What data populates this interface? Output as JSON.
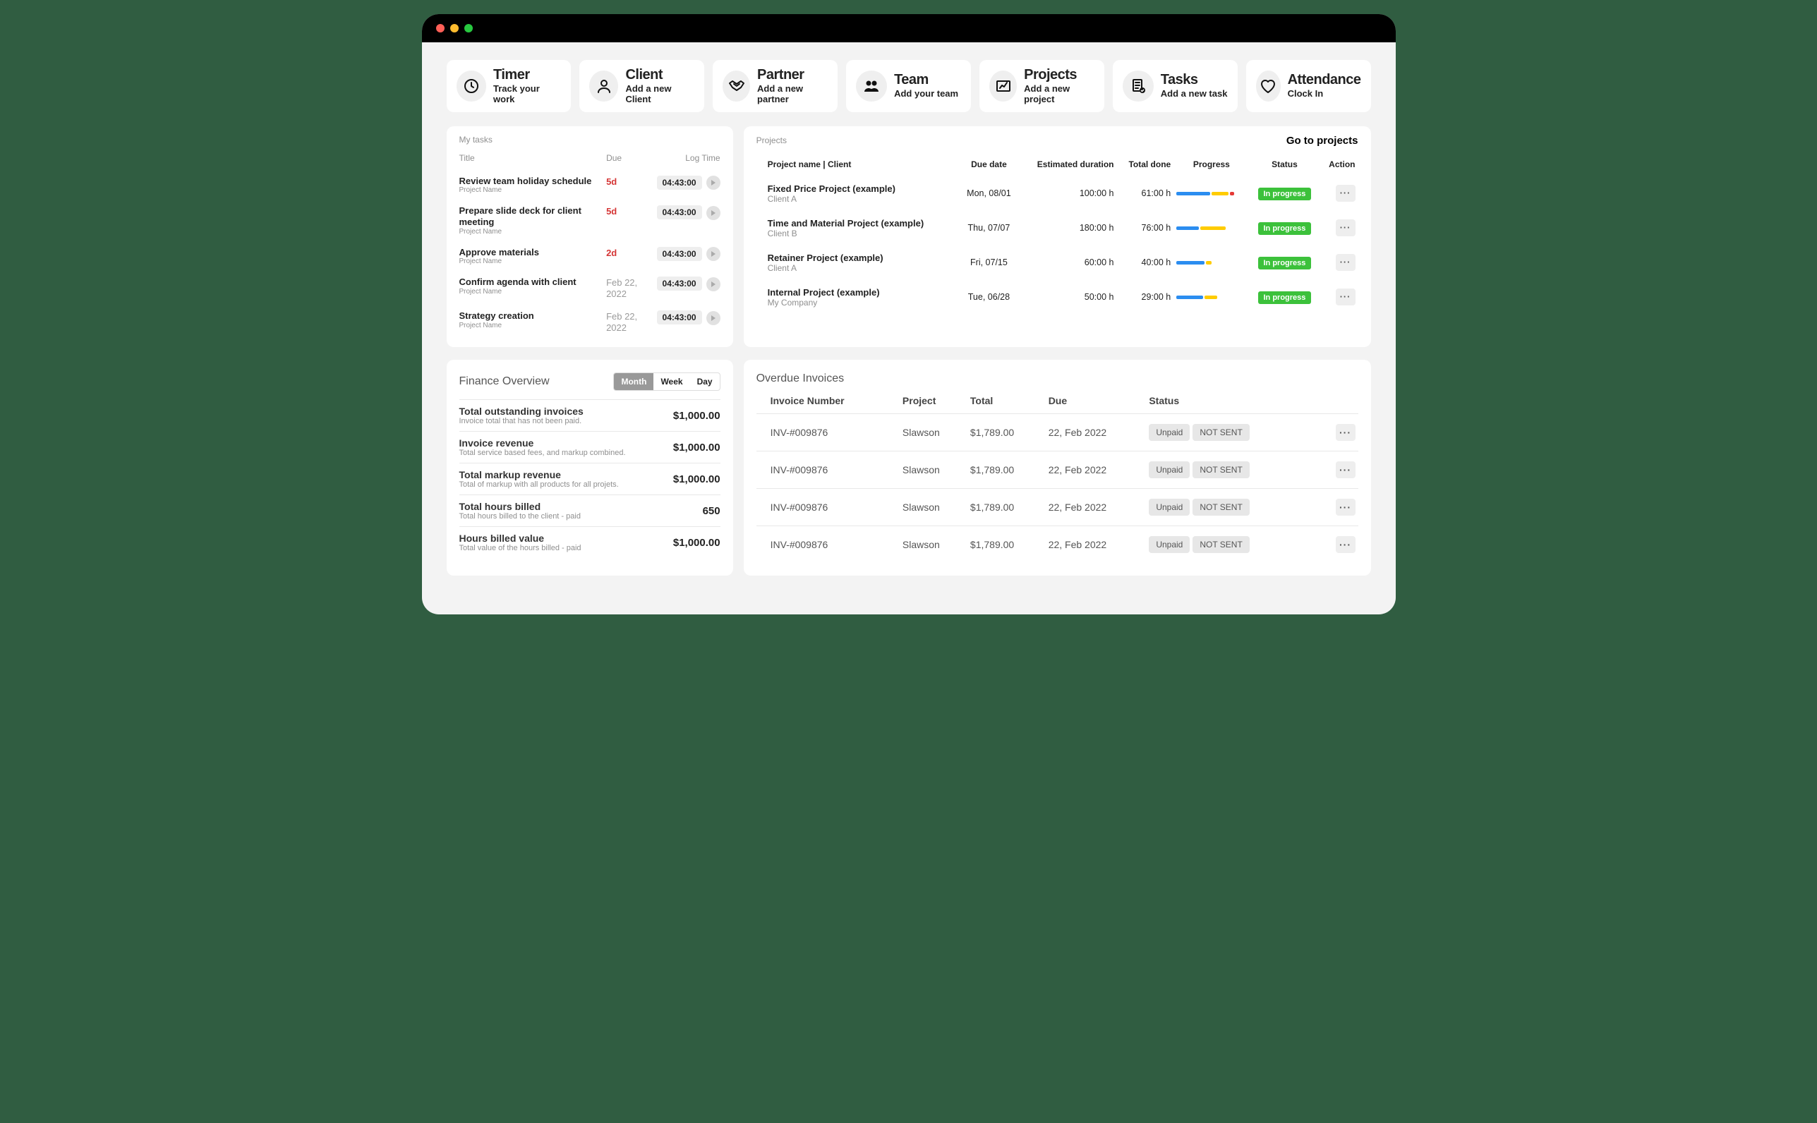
{
  "topCards": [
    {
      "title": "Timer",
      "sub": "Track your work",
      "icon": "clock"
    },
    {
      "title": "Client",
      "sub": "Add a new Client",
      "icon": "user"
    },
    {
      "title": "Partner",
      "sub": "Add a new partner",
      "icon": "handshake"
    },
    {
      "title": "Team",
      "sub": "Add your team",
      "icon": "team"
    },
    {
      "title": "Projects",
      "sub": "Add a new project",
      "icon": "project"
    },
    {
      "title": "Tasks",
      "sub": "Add a new task",
      "icon": "tasks"
    },
    {
      "title": "Attendance",
      "sub": "Clock In",
      "icon": "heart"
    }
  ],
  "mytasks": {
    "title": "My tasks",
    "columns": [
      "Title",
      "Due",
      "Log Time"
    ],
    "rows": [
      {
        "title": "Review team holiday schedule",
        "sub": "Project Name",
        "due": "5d",
        "dueStyle": "red",
        "log": "04:43:00"
      },
      {
        "title": "Prepare slide deck for client meeting",
        "sub": "Project Name",
        "due": "5d",
        "dueStyle": "red",
        "log": "04:43:00"
      },
      {
        "title": "Approve materials",
        "sub": "Project Name",
        "due": "2d",
        "dueStyle": "red",
        "log": "04:43:00"
      },
      {
        "title": "Confirm agenda with client",
        "sub": "Project Name",
        "due": "Feb 22, 2022",
        "dueStyle": "grey",
        "log": "04:43:00"
      },
      {
        "title": "Strategy creation",
        "sub": "Project Name",
        "due": "Feb 22, 2022",
        "dueStyle": "grey",
        "log": "04:43:00"
      }
    ]
  },
  "projects": {
    "title": "Projects",
    "link": "Go to projects",
    "columns": [
      "Project name | Client",
      "Due date",
      "Estimated duration",
      "Total done",
      "Progress",
      "Status",
      "Action"
    ],
    "rows": [
      {
        "name": "Fixed Price Project (example)",
        "client": "Client A",
        "due": "Mon, 08/01",
        "est": "100:00 h",
        "done": "61:00 h",
        "progress": [
          {
            "c": "#2b8df0",
            "w": 48
          },
          {
            "c": "#ffcc00",
            "w": 24
          },
          {
            "c": "#e53935",
            "w": 6
          }
        ],
        "status": "In progress"
      },
      {
        "name": "Time and Material Project (example)",
        "client": "Client B",
        "due": "Thu, 07/07",
        "est": "180:00 h",
        "done": "76:00 h",
        "progress": [
          {
            "c": "#2b8df0",
            "w": 32
          },
          {
            "c": "#ffcc00",
            "w": 36
          }
        ],
        "status": "In progress"
      },
      {
        "name": "Retainer Project (example)",
        "client": "Client A",
        "due": "Fri, 07/15",
        "est": "60:00 h",
        "done": "40:00 h",
        "progress": [
          {
            "c": "#2b8df0",
            "w": 40
          },
          {
            "c": "#ffcc00",
            "w": 8
          }
        ],
        "status": "In progress"
      },
      {
        "name": "Internal Project (example)",
        "client": "My Company",
        "due": "Tue, 06/28",
        "est": "50:00 h",
        "done": "29:00 h",
        "progress": [
          {
            "c": "#2b8df0",
            "w": 38
          },
          {
            "c": "#ffcc00",
            "w": 18
          }
        ],
        "status": "In progress"
      }
    ]
  },
  "finance": {
    "title": "Finance Overview",
    "toggle": [
      "Month",
      "Week",
      "Day"
    ],
    "activeToggle": 0,
    "rows": [
      {
        "label": "Total outstanding invoices",
        "sub": "Invoice total that has not been paid.",
        "value": "$1,000.00"
      },
      {
        "label": "Invoice revenue",
        "sub": "Total service based fees, and markup combined.",
        "value": "$1,000.00"
      },
      {
        "label": "Total markup revenue",
        "sub": "Total of markup with all products for all projets.",
        "value": "$1,000.00"
      },
      {
        "label": "Total hours billed",
        "sub": "Total hours billed to the client - paid",
        "value": "650"
      },
      {
        "label": "Hours billed value",
        "sub": "Total value of the hours billed - paid",
        "value": "$1,000.00"
      }
    ]
  },
  "invoices": {
    "title": "Overdue Invoices",
    "columns": [
      "Invoice Number",
      "Project",
      "Total",
      "Due",
      "Status",
      ""
    ],
    "rows": [
      {
        "num": "INV-#009876",
        "project": "Slawson",
        "total": "$1,789.00",
        "due": "22, Feb 2022",
        "status1": "Unpaid",
        "status2": "NOT SENT"
      },
      {
        "num": "INV-#009876",
        "project": "Slawson",
        "total": "$1,789.00",
        "due": "22, Feb 2022",
        "status1": "Unpaid",
        "status2": "NOT SENT"
      },
      {
        "num": "INV-#009876",
        "project": "Slawson",
        "total": "$1,789.00",
        "due": "22, Feb 2022",
        "status1": "Unpaid",
        "status2": "NOT SENT"
      },
      {
        "num": "INV-#009876",
        "project": "Slawson",
        "total": "$1,789.00",
        "due": "22, Feb 2022",
        "status1": "Unpaid",
        "status2": "NOT SENT"
      }
    ]
  }
}
